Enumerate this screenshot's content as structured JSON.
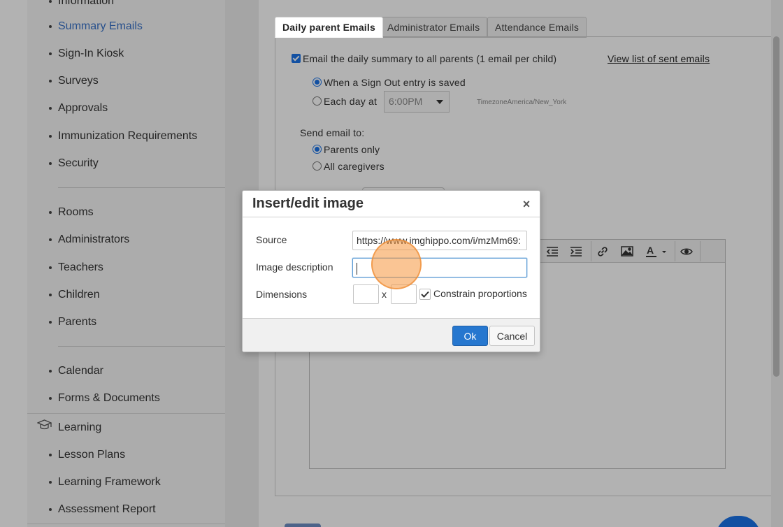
{
  "sidebar": {
    "items_top": [
      {
        "label": "Information"
      },
      {
        "label": "Summary Emails",
        "active": true
      },
      {
        "label": "Sign-In Kiosk"
      },
      {
        "label": "Surveys"
      },
      {
        "label": "Approvals"
      },
      {
        "label": "Immunization Requirements"
      },
      {
        "label": "Security"
      }
    ],
    "items_people": [
      {
        "label": "Rooms"
      },
      {
        "label": "Administrators"
      },
      {
        "label": "Teachers"
      },
      {
        "label": "Children"
      },
      {
        "label": "Parents"
      }
    ],
    "items_docs": [
      {
        "label": "Calendar"
      },
      {
        "label": "Forms & Documents"
      }
    ],
    "learning_section": {
      "label": "Learning",
      "icon": "graduation-cap-icon"
    },
    "items_learning": [
      {
        "label": "Lesson Plans"
      },
      {
        "label": "Learning Framework"
      },
      {
        "label": "Assessment Report"
      }
    ]
  },
  "tabs": [
    {
      "label": "Daily parent Emails",
      "active": true
    },
    {
      "label": "Administrator Emails",
      "active": false
    },
    {
      "label": "Attendance Emails",
      "active": false
    }
  ],
  "daily": {
    "email_all_label": "Email the daily summary to all parents (1 email per child)",
    "email_all_checked": true,
    "view_sent_link": "View list of sent emails",
    "when_signout_label": "When a Sign Out entry is saved",
    "each_day_label": "Each day at",
    "time_value": "6:00PM",
    "timezone": "TimezoneAmerica/New_York",
    "send_to_label": "Send email to:",
    "parents_only_label": "Parents only",
    "all_caregivers_label": "All caregivers"
  },
  "editor_toolbar": {
    "icons": [
      "outdent-icon",
      "indent-icon",
      "link-icon",
      "image-icon",
      "text-color-icon",
      "preview-icon"
    ]
  },
  "modal": {
    "title": "Insert/edit image",
    "close_glyph": "×",
    "source_label": "Source",
    "source_value": "https://www.imghippo.com/i/mzMm69:",
    "description_label": "Image description",
    "description_value": "",
    "dimensions_label": "Dimensions",
    "dimensions_separator": "x",
    "width_value": "",
    "height_value": "",
    "constrain_label": "Constrain proportions",
    "constrain_checked": true,
    "ok_label": "Ok",
    "cancel_label": "Cancel"
  },
  "colors": {
    "accent": "#2677cf",
    "active_link": "#3a73c9",
    "click_marker": "#f5963c"
  }
}
